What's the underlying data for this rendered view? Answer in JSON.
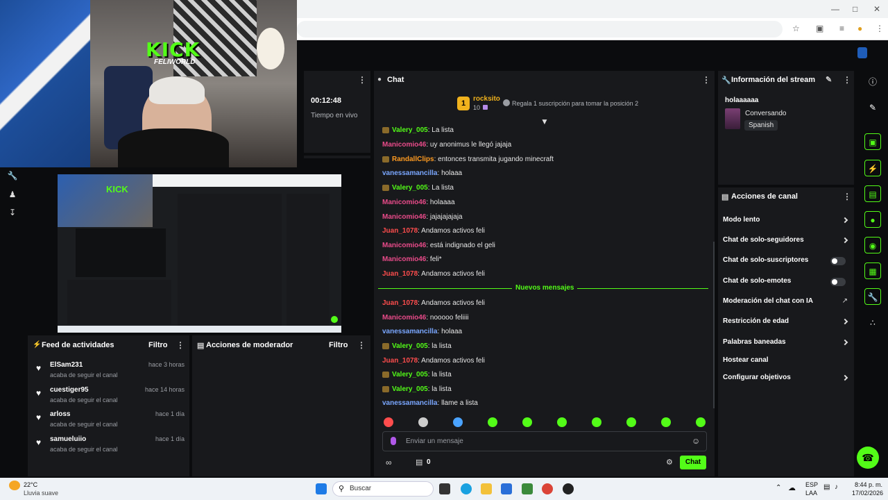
{
  "stream": {
    "elapsed": "00:12:48",
    "status_label": "Tiempo en vivo",
    "webcam_logo": "KICK",
    "webcam_sublogo": "FELIWORLD"
  },
  "chat": {
    "title": "Chat",
    "top_gifter": {
      "rank": "1",
      "name": "rocksito",
      "count": "10"
    },
    "gift_prompt": "Regala 1 suscripción para tomar la posición 2",
    "new_messages_label": "Nuevos mensajes",
    "input_placeholder": "Enviar un mensaje",
    "points": "0",
    "send_label": "Chat",
    "messages": [
      {
        "user": "Valery_005",
        "text": "La lista",
        "color": "#53fc18",
        "badge": true
      },
      {
        "user": "Manicomio46",
        "text": "uy anonimus le llegó jajaja",
        "color": "#e94b8a",
        "badge": false
      },
      {
        "user": "RandallClips",
        "text": "entonces transmita jugando minecraft",
        "color": "#ff9b21",
        "badge": true
      },
      {
        "user": "vanessamancilla",
        "text": "holaaa",
        "color": "#7aa7ff",
        "badge": false
      },
      {
        "user": "Valery_005",
        "text": "La lista",
        "color": "#53fc18",
        "badge": true
      },
      {
        "user": "Manicomio46",
        "text": "holaaaa",
        "color": "#e94b8a",
        "badge": false
      },
      {
        "user": "Manicomio46",
        "text": "jajajajajaja",
        "color": "#e94b8a",
        "badge": false
      },
      {
        "user": "Juan_1078",
        "text": "Andamos activos feli",
        "color": "#ff4d4d",
        "badge": false
      },
      {
        "user": "Manicomio46",
        "text": "está indignado el geli",
        "color": "#e94b8a",
        "badge": false
      },
      {
        "user": "Manicomio46",
        "text": "feli*",
        "color": "#e94b8a",
        "badge": false
      },
      {
        "user": "Juan_1078",
        "text": "Andamos activos feli",
        "color": "#ff4d4d",
        "badge": false
      },
      {
        "user": "Juan_1078",
        "text": "Andamos activos feli",
        "color": "#ff4d4d",
        "badge": false
      },
      {
        "user": "Manicomio46",
        "text": "nooooo feliiii",
        "color": "#e94b8a",
        "badge": false
      },
      {
        "user": "vanessamancilla",
        "text": "holaaa",
        "color": "#7aa7ff",
        "badge": false
      },
      {
        "user": "Valery_005",
        "text": "la lista",
        "color": "#53fc18",
        "badge": true
      },
      {
        "user": "Juan_1078",
        "text": "Andamos activos feli",
        "color": "#ff4d4d",
        "badge": false
      },
      {
        "user": "Valery_005",
        "text": "la lista",
        "color": "#53fc18",
        "badge": true
      },
      {
        "user": "Valery_005",
        "text": "la lista",
        "color": "#53fc18",
        "badge": true
      },
      {
        "user": "vanessamancilla",
        "text": "llame a lista",
        "color": "#7aa7ff",
        "badge": false
      }
    ],
    "emote_colors": [
      "#ff4d4d",
      "#cccccc",
      "#4aa3ff",
      "#53fc18",
      "#53fc18",
      "#53fc18",
      "#53fc18",
      "#53fc18",
      "#53fc18",
      "#53fc18"
    ]
  },
  "stream_info": {
    "title": "Información del stream",
    "stream_title": "holaaaaaa",
    "category": "Conversando",
    "language": "Spanish"
  },
  "channel_actions": {
    "title": "Acciones de canal",
    "items": [
      {
        "label": "Modo lento",
        "control": "chevron"
      },
      {
        "label": "Chat de solo-seguidores",
        "control": "chevron"
      },
      {
        "label": "Chat de solo-suscriptores",
        "control": "toggle"
      },
      {
        "label": "Chat de solo-emotes",
        "control": "toggle"
      },
      {
        "label": "Moderación del chat con IA",
        "control": "external"
      },
      {
        "label": "Restricción de edad",
        "control": "chevron"
      },
      {
        "label": "Palabras baneadas",
        "control": "chevron"
      },
      {
        "label": "Hostear canal",
        "control": "none"
      },
      {
        "label": "Configurar objetivos",
        "control": "chevron"
      }
    ]
  },
  "activity_feed": {
    "title": "Feed de actividades",
    "filter_label": "Filtro",
    "items": [
      {
        "name": "ElSam231",
        "sub": "acaba de seguir el canal",
        "time": "hace 3 horas"
      },
      {
        "name": "cuestiger95",
        "sub": "acaba de seguir el canal",
        "time": "hace 14 horas"
      },
      {
        "name": "arloss",
        "sub": "acaba de seguir el canal",
        "time": "hace 1 día"
      },
      {
        "name": "samueluiio",
        "sub": "acaba de seguir el canal",
        "time": "hace 1 día"
      }
    ]
  },
  "mod_actions": {
    "title": "Acciones de moderador",
    "filter_label": "Filtro"
  },
  "taskbar": {
    "weather_temp": "22°C",
    "weather_desc": "Lluvia suave",
    "search_placeholder": "Buscar",
    "lang_top": "ESP",
    "lang_bottom": "LAA",
    "time": "8:44 p. m.",
    "date": "17/02/2026"
  },
  "colors": {
    "accent": "#53fc18",
    "panel": "#18191c",
    "background": "#0b0c0e"
  }
}
